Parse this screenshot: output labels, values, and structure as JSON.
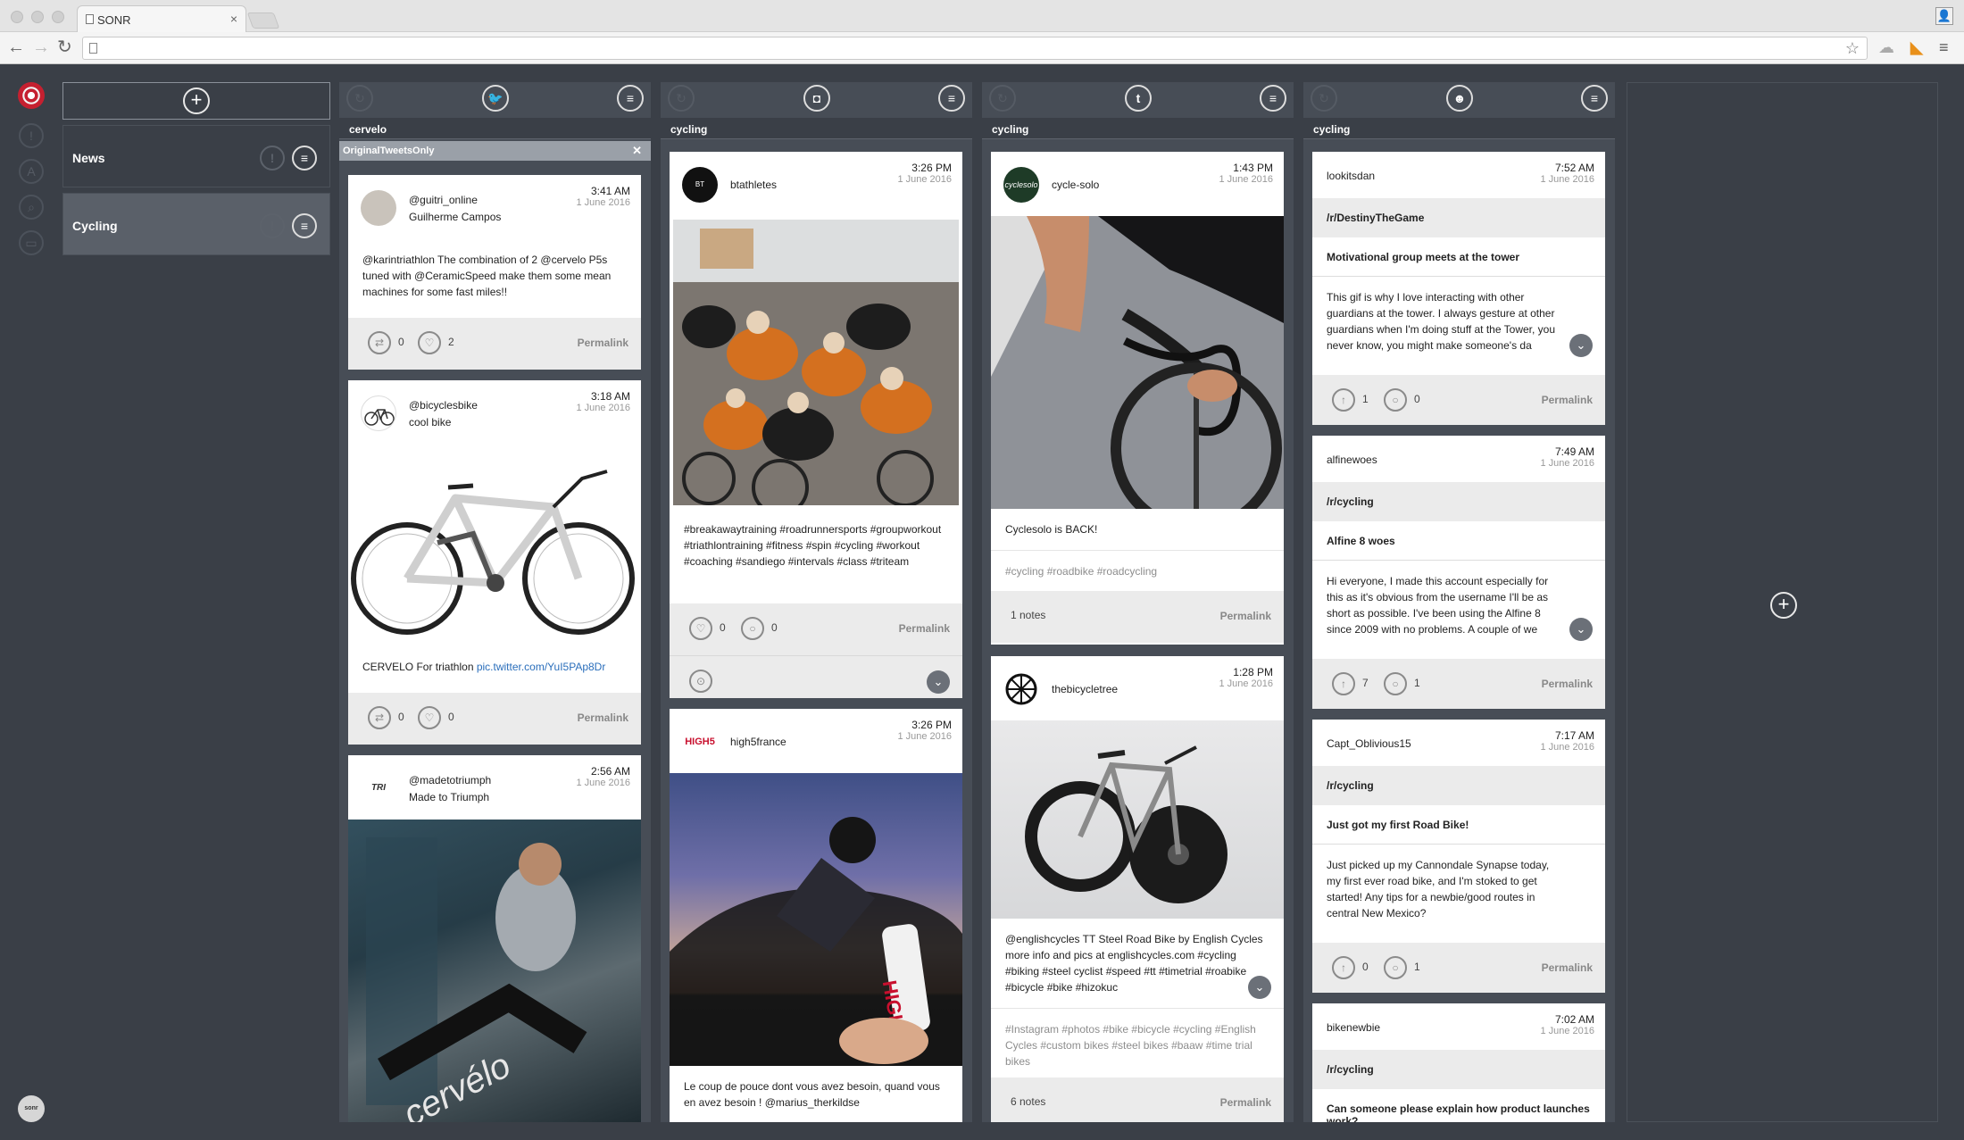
{
  "browser": {
    "tab_title": "SONR",
    "tab_close": "×",
    "profile_icon": "person-icon",
    "url": ""
  },
  "sidebar": {
    "add_icon": "+",
    "streams": [
      {
        "label": "News",
        "active": false
      },
      {
        "label": "Cycling",
        "active": true
      }
    ],
    "badge": "sonr"
  },
  "colors": {
    "background": "#3a3f47",
    "column": "#474d56",
    "accent": "#c52030",
    "link": "#2a6ebb"
  },
  "columns": [
    {
      "network": "twitter",
      "network_icon": "twitter-icon",
      "query": "cervelo",
      "filter": "OriginalTweetsOnly",
      "posts": [
        {
          "handle": "@guitri_online",
          "name": "Guilherme Campos",
          "time": "3:41 AM",
          "date": "1 June 2016",
          "text": "@karintriathlon The combination of 2 @cervelo P5s tuned with @CeramicSpeed make them some mean machines for some fast miles!!",
          "retweets": "0",
          "likes": "2",
          "permalink": "Permalink"
        },
        {
          "handle": "@bicyclesbike",
          "name": "cool bike",
          "time": "3:18 AM",
          "date": "1 June 2016",
          "text": "CERVELO For triathlon ",
          "link": "pic.twitter.com/YuI5PAp8Dr",
          "retweets": "0",
          "likes": "0",
          "permalink": "Permalink"
        },
        {
          "handle": "@madetotriumph",
          "name": "Made to Triumph",
          "time": "2:56 AM",
          "date": "1 June 2016"
        }
      ]
    },
    {
      "network": "instagram",
      "network_icon": "instagram-icon",
      "query": "cycling",
      "posts": [
        {
          "user": "btathletes",
          "time": "3:26 PM",
          "date": "1 June 2016",
          "text": "#breakawaytraining #roadrunnersports #groupworkout #triathlontraining #fitness #spin #cycling #workout #coaching #sandiego #intervals #class #triteam",
          "likes": "0",
          "comments": "0",
          "permalink": "Permalink"
        },
        {
          "user": "high5france",
          "time": "3:26 PM",
          "date": "1 June 2016",
          "text": "Le coup de pouce dont vous avez besoin, quand vous en avez besoin ! @marius_therkildse"
        }
      ]
    },
    {
      "network": "tumblr",
      "network_icon": "tumblr-icon",
      "query": "cycling",
      "posts": [
        {
          "user": "cycle-solo",
          "time": "1:43 PM",
          "date": "1 June 2016",
          "text": "Cyclesolo is BACK!",
          "tags": "#cycling  #roadbike  #roadcycling",
          "notes": "1  notes",
          "permalink": "Permalink"
        },
        {
          "user": "thebicycletree",
          "time": "1:28 PM",
          "date": "1 June 2016",
          "text": "@englishcycles TT Steel Road Bike by English Cycles more info and pics at englishcycles.com #cycling #biking #steel cyclist #speed #tt #timetrial #roabike #bicycle #bike #hizokuc",
          "tags": "#Instagram  #photos  #bike  #bicycle  #cycling  #English Cycles  #custom bikes  #steel bikes  #baaw  #time trial bikes",
          "notes": "6  notes",
          "permalink": "Permalink"
        }
      ]
    },
    {
      "network": "reddit",
      "network_icon": "reddit-icon",
      "query": "cycling",
      "posts": [
        {
          "user": "lookitsdan",
          "time": "7:52 AM",
          "date": "1 June 2016",
          "subreddit": "/r/DestinyTheGame",
          "title": "Motivational group meets at the tower",
          "text": "This gif is why I love interacting with other guardians at the tower. I always gesture at other guardians when I'm doing stuff at the Tower, you never know, you might make someone's da",
          "upvotes": "1",
          "comments": "0",
          "permalink": "Permalink"
        },
        {
          "user": "alfinewoes",
          "time": "7:49 AM",
          "date": "1 June 2016",
          "subreddit": "/r/cycling",
          "title": "Alfine 8 woes",
          "text": "Hi everyone, I made this account especially for this as it's obvious from the username I'll be as short as possible. I've been using the Alfine 8 since 2009 with no problems. A couple of we",
          "upvotes": "7",
          "comments": "1",
          "permalink": "Permalink"
        },
        {
          "user": "Capt_Oblivious15",
          "time": "7:17 AM",
          "date": "1 June 2016",
          "subreddit": "/r/cycling",
          "title": "Just got my first Road Bike!",
          "text": "Just picked up my Cannondale Synapse today, my first ever road bike, and I'm stoked to get started! Any tips for a newbie/good routes in central New Mexico?",
          "upvotes": "0",
          "comments": "1",
          "permalink": "Permalink"
        },
        {
          "user": "bikenewbie",
          "time": "7:02 AM",
          "date": "1 June 2016",
          "subreddit": "/r/cycling",
          "title": "Can someone please explain how product launches work?"
        }
      ]
    }
  ]
}
